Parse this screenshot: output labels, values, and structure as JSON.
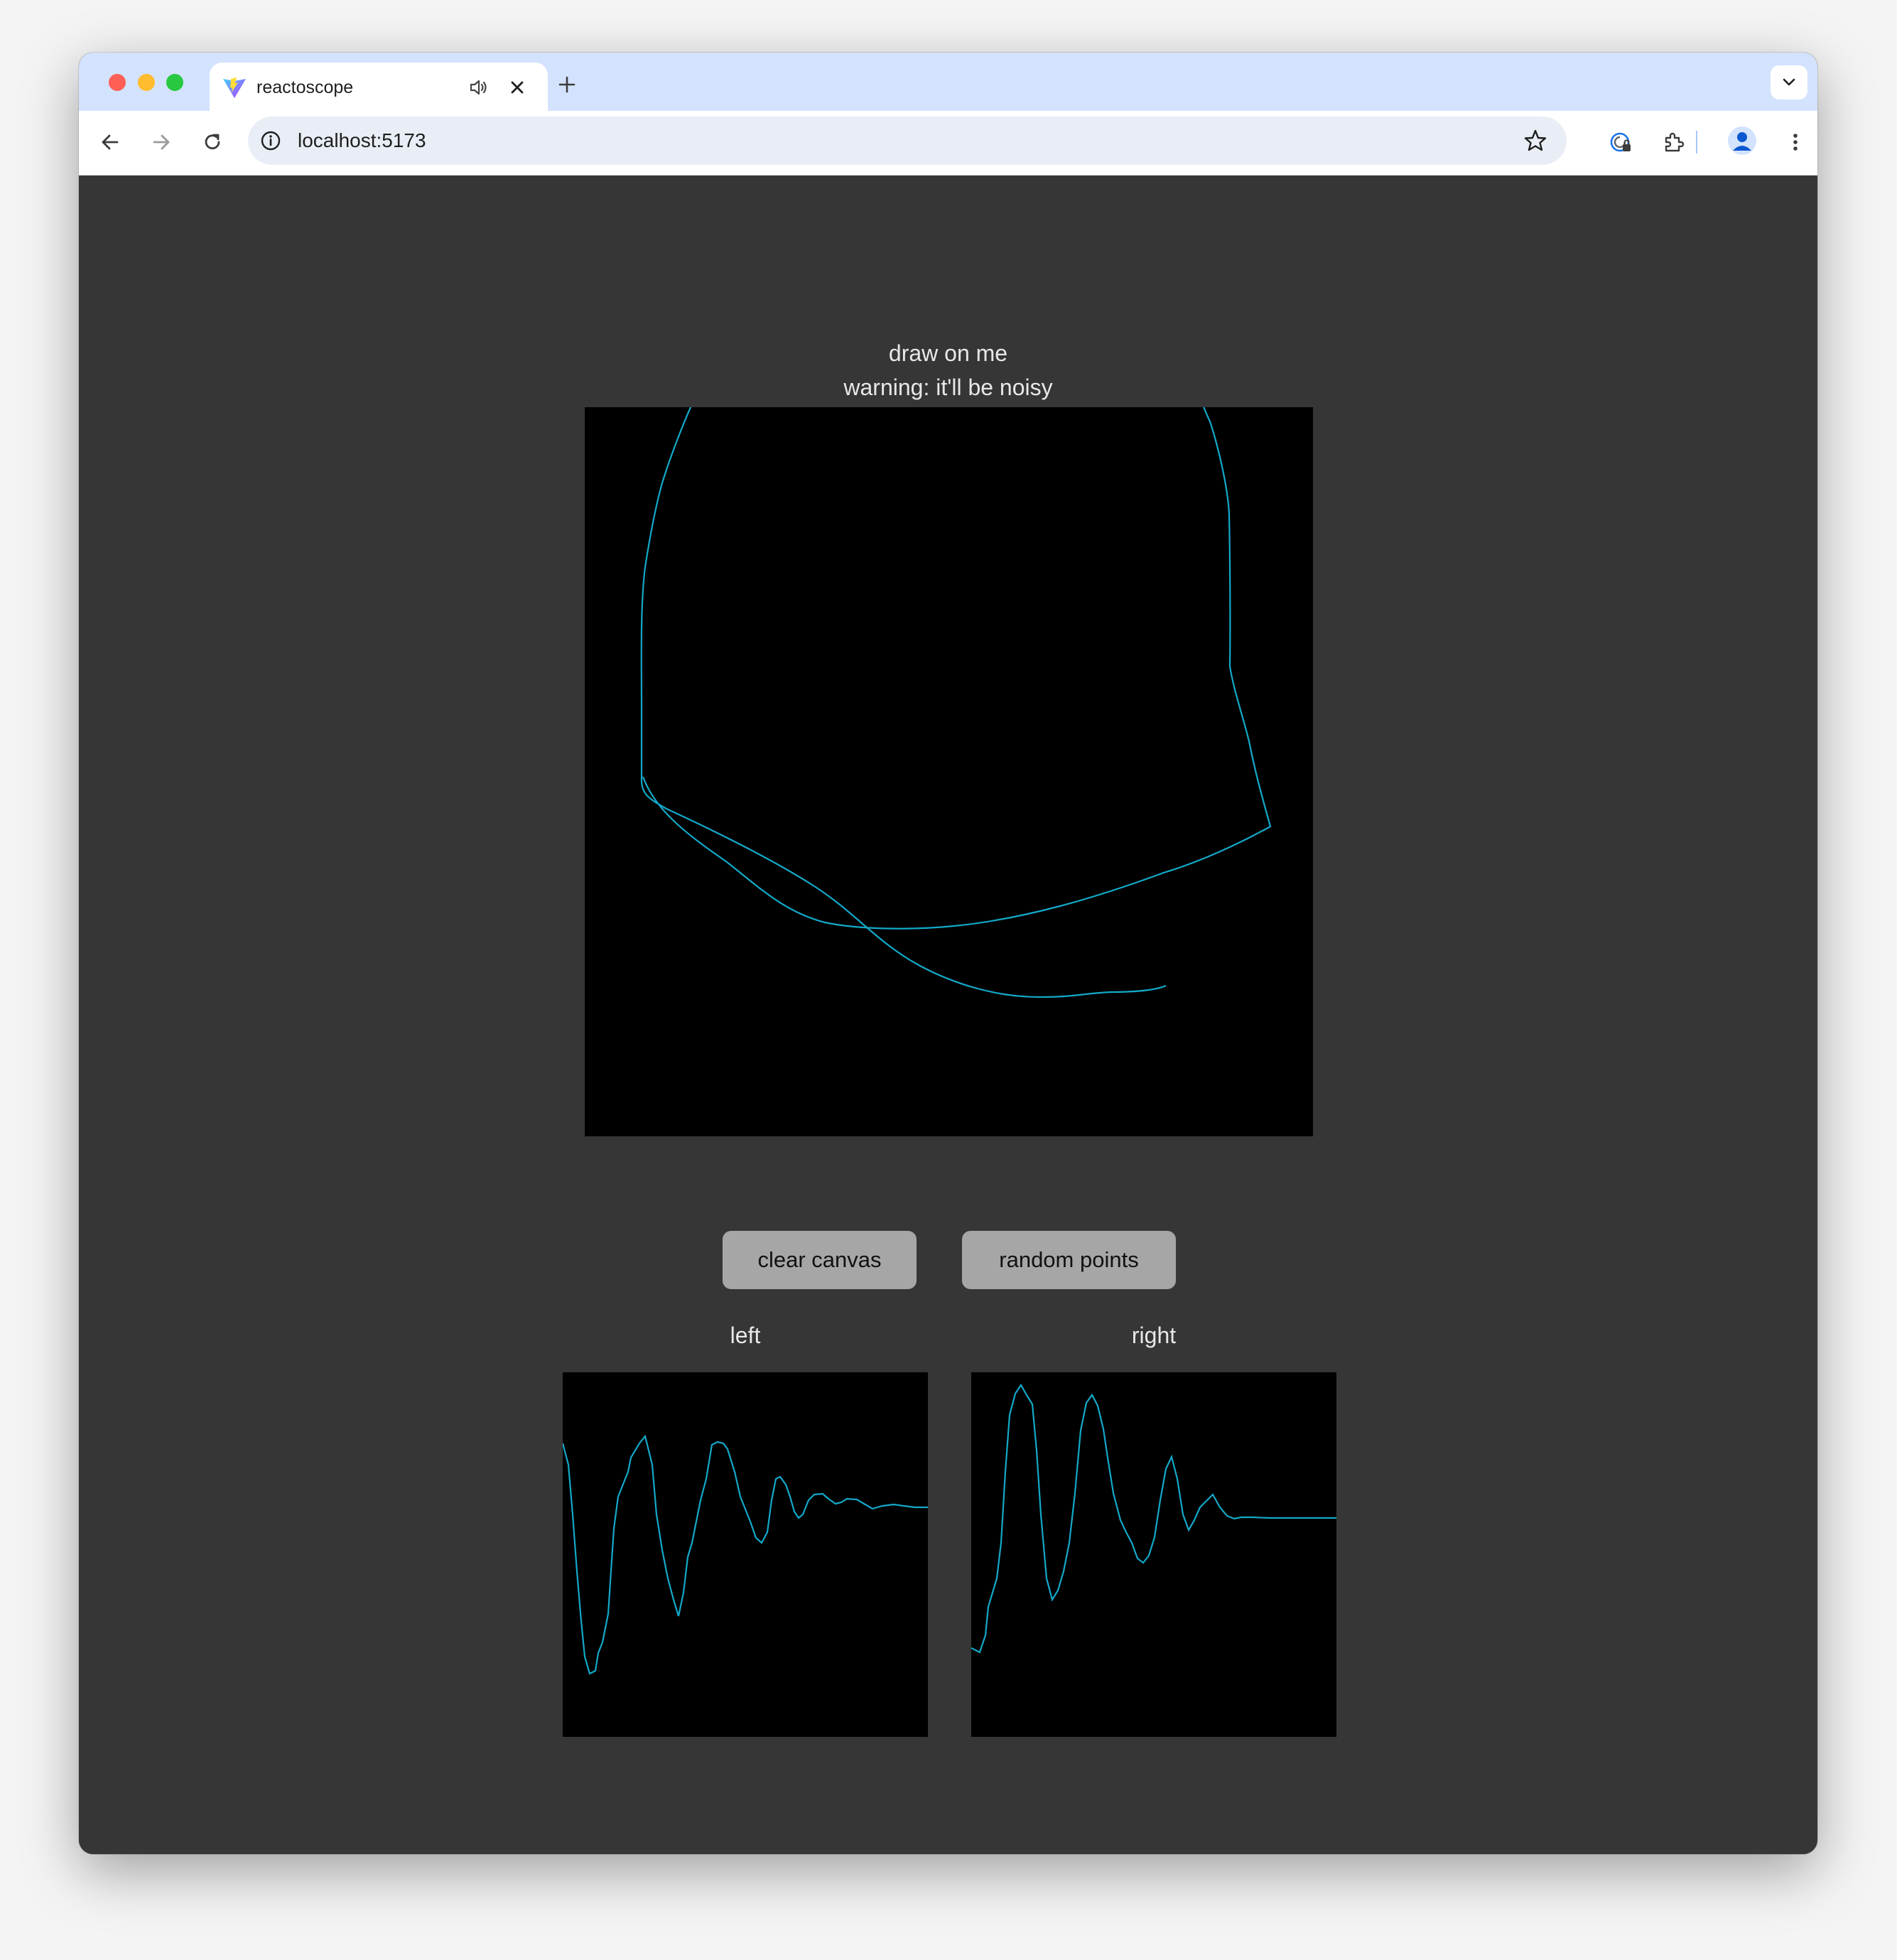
{
  "browser": {
    "tab": {
      "title": "reactoscope"
    },
    "address_bar": {
      "url": "localhost:5173"
    }
  },
  "page": {
    "heading_line1": "draw on me",
    "heading_line2": "warning: it'll be noisy",
    "buttons": {
      "clear_label": "clear canvas",
      "random_label": "random points"
    },
    "scopes": {
      "left_label": "left",
      "right_label": "right"
    }
  },
  "colors": {
    "trace": "#13a9c9",
    "page_background": "#363636",
    "canvas_background": "#000000",
    "button_background": "#a6a6a6"
  },
  "icons": [
    "vite-favicon",
    "speaker-icon",
    "close-icon",
    "plus-icon",
    "chevron-down-icon",
    "back-arrow-icon",
    "forward-arrow-icon",
    "reload-icon",
    "info-icon",
    "star-icon",
    "password-manager-icon",
    "extensions-icon",
    "profile-icon",
    "more-vert-icon"
  ]
}
